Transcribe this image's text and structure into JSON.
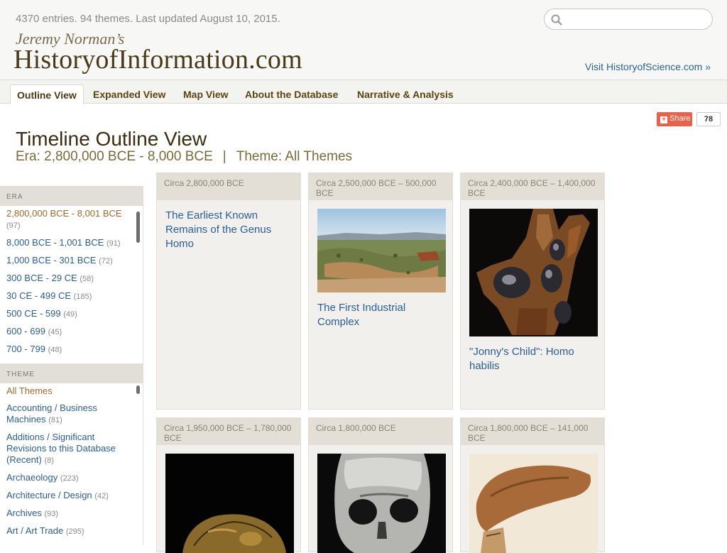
{
  "header": {
    "stats": "4370 entries. 94 themes. Last updated August 10, 2015.",
    "logo_small": "Jeremy Norman’s",
    "logo_big": "HistoryofInformation.com",
    "search_placeholder": "",
    "visit_link": "Visit HistoryofScience.com »"
  },
  "nav": {
    "tabs": [
      "Outline View",
      "Expanded View",
      "Map View",
      "About the Database",
      "Narrative & Analysis"
    ],
    "active_index": 0
  },
  "share": {
    "label": "Share",
    "count": "78"
  },
  "page": {
    "title": "Timeline Outline View",
    "era_text": "Era: 2,800,000 BCE - 8,000 BCE",
    "separator": "|",
    "theme_text": "Theme: All Themes"
  },
  "sidebar": {
    "era_header": "ERA",
    "era_items": [
      {
        "label": "2,800,000 BCE - 8,001 BCE",
        "count": "(97)",
        "active": true
      },
      {
        "label": "8,000 BCE - 1,001 BCE",
        "count": "(91)"
      },
      {
        "label": "1,000 BCE - 301 BCE",
        "count": "(72)"
      },
      {
        "label": "300 BCE - 29 CE",
        "count": "(58)"
      },
      {
        "label": "30 CE - 499 CE",
        "count": "(185)"
      },
      {
        "label": "500 CE - 599",
        "count": "(49)"
      },
      {
        "label": "600 - 699",
        "count": "(45)"
      },
      {
        "label": "700 - 799",
        "count": "(48)"
      }
    ],
    "theme_header": "THEME",
    "theme_items": [
      {
        "label": "All Themes",
        "count": "",
        "active": true
      },
      {
        "label": "Accounting / Business Machines",
        "count": "(81)"
      },
      {
        "label": "Additions / Significant Revisions to this Database (Recent)",
        "count": "(8)"
      },
      {
        "label": "Archaeology",
        "count": "(223)"
      },
      {
        "label": "Architecture / Design",
        "count": "(42)"
      },
      {
        "label": "Archives",
        "count": "(93)"
      },
      {
        "label": "Art / Art Trade",
        "count": "(295)"
      }
    ]
  },
  "cards": [
    {
      "date": "Circa 2,800,000 BCE",
      "title": "The Earliest Known Remains of the Genus Homo",
      "image": null
    },
    {
      "date": "Circa 2,500,000 BCE – 500,000 BCE",
      "title": "The First Industrial Complex",
      "image": "landscape"
    },
    {
      "date": "Circa 2,400,000 BCE – 1,400,000 BCE",
      "title": "\"Jonny's Child\": Homo habilis",
      "image": "jaw"
    },
    {
      "date": "Circa 1,950,000 BCE – 1,780,000 BCE",
      "title": "",
      "image": "skull-brown"
    },
    {
      "date": "Circa 1,800,000 BCE",
      "title": "",
      "image": "skull-bw"
    },
    {
      "date": "Circa 1,800,000 BCE – 141,000 BCE",
      "title": "",
      "image": "fossil-sepia"
    }
  ],
  "colors": {
    "link": "#2a5e96",
    "brand_dark": "#4a3a1a",
    "share": "#e8614a"
  }
}
